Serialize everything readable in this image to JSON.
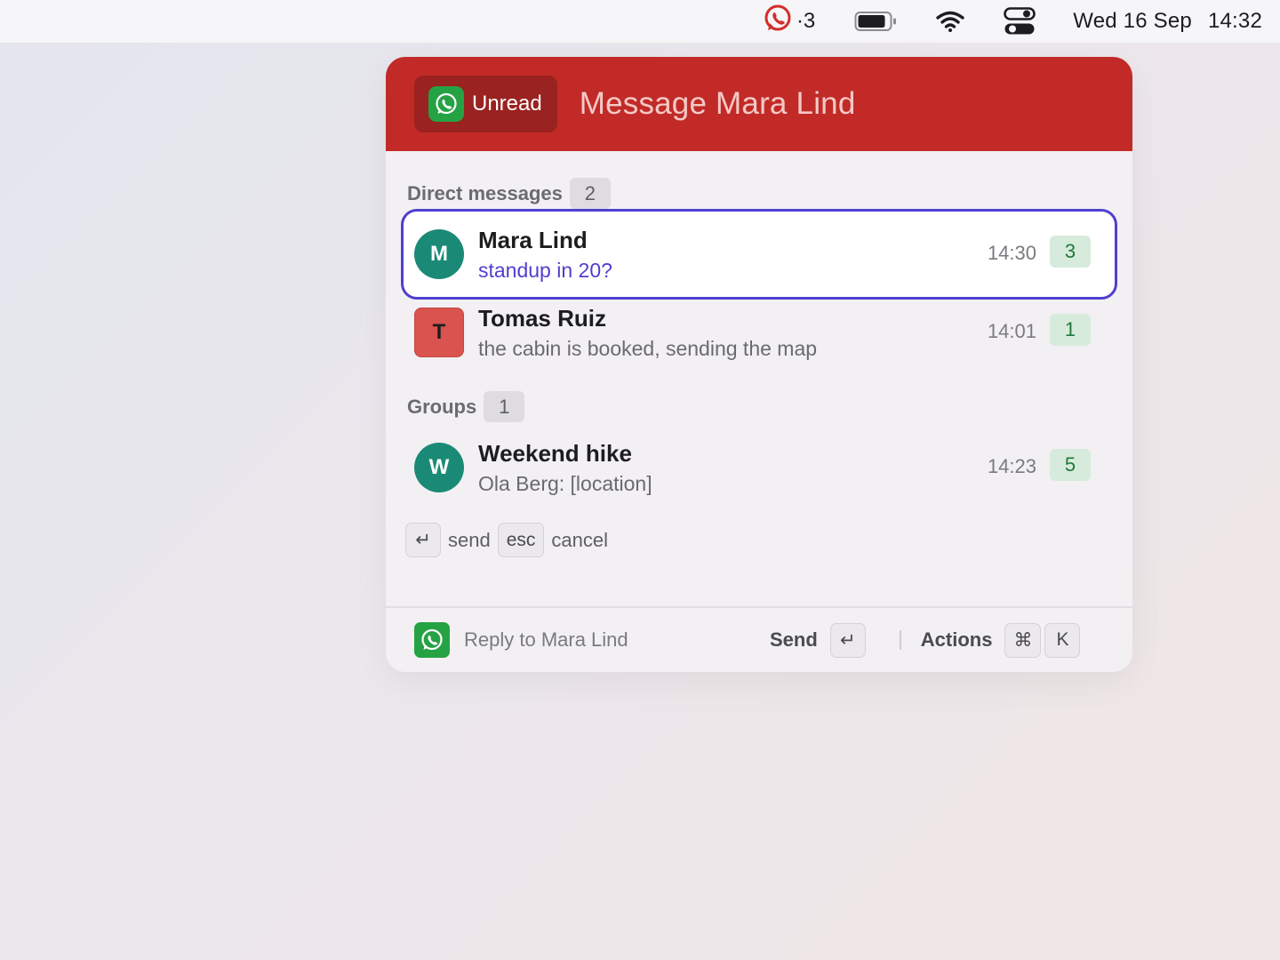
{
  "menubar": {
    "app_badge_count": "·3",
    "date": "Wed 16 Sep",
    "time": "14:32",
    "icons": [
      "whatsapp-icon",
      "battery-icon",
      "wifi-icon",
      "control-center-icon"
    ]
  },
  "header": {
    "filter_label": "Unread",
    "title": "Message Mara Lind"
  },
  "sections": {
    "direct": {
      "label": "Direct messages",
      "count": "2"
    },
    "groups": {
      "label": "Groups",
      "count": "1"
    }
  },
  "chats": [
    {
      "initial": "M",
      "name": "Mara Lind",
      "preview": "standup in 20?",
      "time": "14:30",
      "unread": "3"
    },
    {
      "initial": "T",
      "name": "Tomas Ruiz",
      "preview": "the cabin is booked, sending the map",
      "time": "14:01",
      "unread": "1"
    },
    {
      "initial": "W",
      "name": "Weekend hike",
      "preview": "Ola Berg: [location]",
      "time": "14:23",
      "unread": "5"
    }
  ],
  "hints": {
    "enter_key": "↵",
    "send": "send",
    "esc_key": "esc",
    "cancel": "cancel"
  },
  "footer": {
    "reply_placeholder": "Reply to Mara Lind",
    "reply_value": "",
    "send_label": "Send",
    "send_key": "↵",
    "actions_label": "Actions",
    "cmd_key": "⌘",
    "k_key": "K"
  },
  "colors": {
    "header_red": "#c12a27",
    "whatsapp_green": "#25a244",
    "selection_purple": "#4f3fd0",
    "avatar_teal": "#1a8a76",
    "avatar_red": "#d9534f"
  }
}
